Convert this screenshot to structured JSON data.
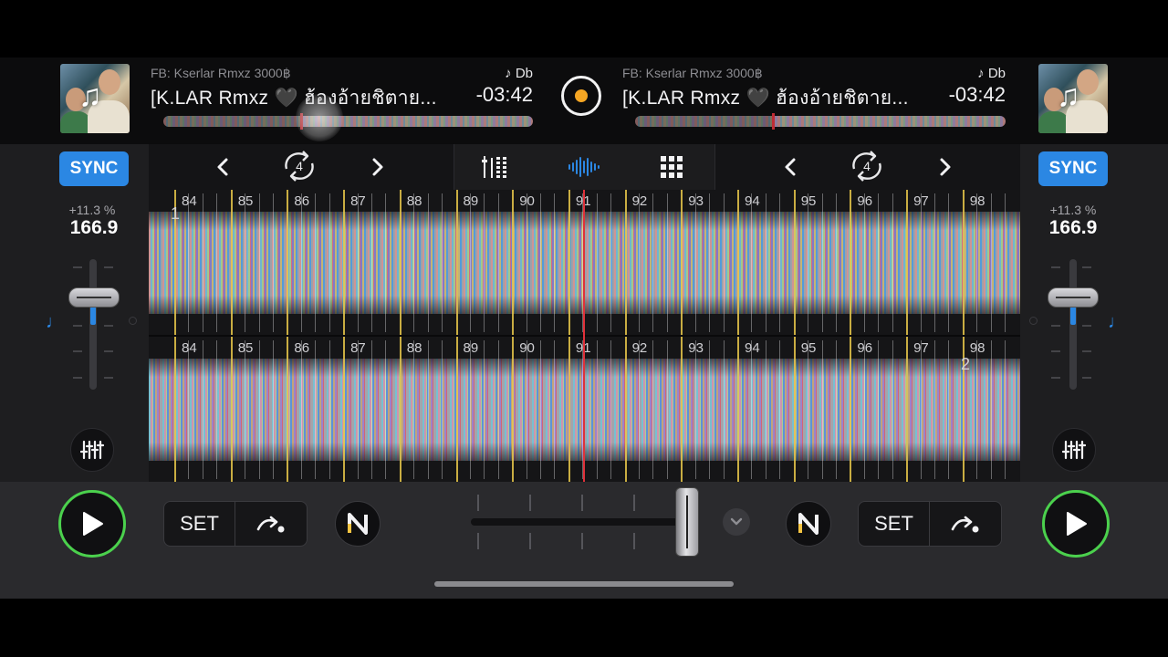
{
  "deckA": {
    "artist": "FB: Kserlar Rmxz 3000฿",
    "key": "♪ Db",
    "title": "[K.LAR Rmxz 🖤 ฮ้องอ้ายชิตาย...",
    "remaining": "-03:42",
    "pitch_percent": "+11.3 %",
    "bpm": "166.9",
    "sync_label": "SYNC",
    "loop_size": "4",
    "set_label": "SET",
    "playhead_position": 0.22
  },
  "deckB": {
    "artist": "FB: Kserlar Rmxz 3000฿",
    "key": "♪ Db",
    "title": "[K.LAR Rmxz 🖤 ฮ้องอ้ายชิตาย...",
    "remaining": "-03:42",
    "pitch_percent": "+11.3 %",
    "bpm": "166.9",
    "sync_label": "SYNC",
    "loop_size": "4",
    "set_label": "SET",
    "playhead_position": 0.22
  },
  "waveform": {
    "bar_numbers": [
      "84",
      "85",
      "86",
      "87",
      "88",
      "89",
      "90",
      "91",
      "92",
      "93",
      "94",
      "95",
      "96",
      "97",
      "98"
    ],
    "cue_top": "1",
    "cue_bottom": "2"
  },
  "crossfader": {
    "position": 1.0
  },
  "colors": {
    "sync": "#2b87e3",
    "play_ring": "#4bd14d",
    "playhead": "#e0313a",
    "beat_marker": "#e9c84a",
    "record_dot": "#f5a623"
  },
  "icons": {
    "eq": "sliders-icon",
    "mixer": "mixer-icon",
    "waveform": "waveform-icon",
    "pads": "grid-icon",
    "loop": "loop-icon",
    "cue_jump": "cue-jump-icon",
    "neural": "neural-mix-icon"
  }
}
